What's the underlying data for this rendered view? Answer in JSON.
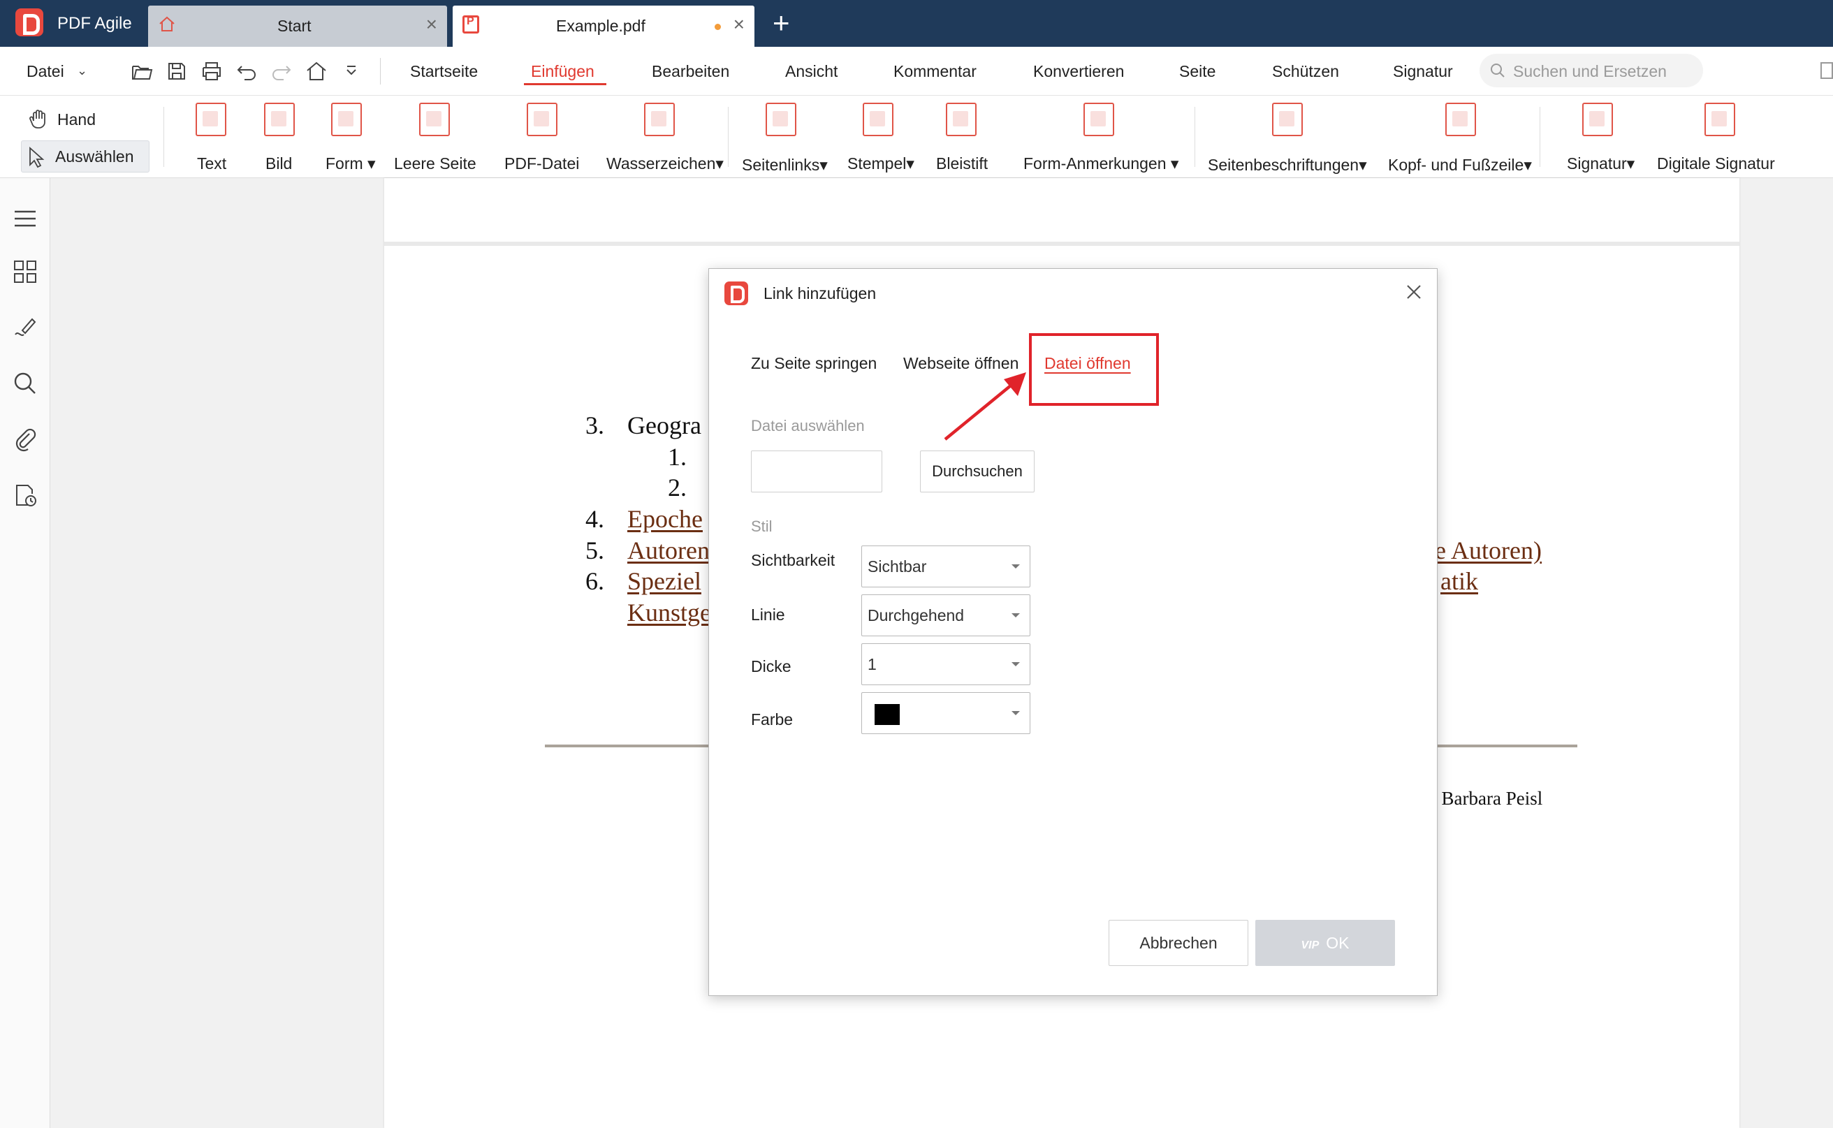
{
  "app": {
    "name": "PDF Agile",
    "tabs": [
      {
        "label": "Start"
      },
      {
        "label": "Example.pdf"
      }
    ]
  },
  "menubar": {
    "file_label": "Datei",
    "tabs": [
      "Startseite",
      "Einfügen",
      "Bearbeiten",
      "Ansicht",
      "Kommentar",
      "Konvertieren",
      "Seite",
      "Schützen",
      "Signatur"
    ],
    "active_tab": "Einfügen",
    "search_placeholder": "Suchen und Ersetzen"
  },
  "ribbon": {
    "hand_label": "Hand",
    "select_label": "Auswählen",
    "buttons": [
      "Text",
      "Bild",
      "Form ▾",
      "Leere Seite",
      "PDF-Datei",
      "Wasserzeichen▾",
      "Seitenlinks▾",
      "Stempel▾",
      "Bleistift",
      "Form-Anmerkungen ▾",
      "Seitenbeschriftungen▾",
      "Kopf- und Fußzeile▾",
      "Signatur▾",
      "Digitale Signatur"
    ]
  },
  "document": {
    "lines": [
      {
        "num": "3.",
        "text": "Geogra",
        "link": false
      },
      {
        "num": "1.",
        "text": "",
        "link": false
      },
      {
        "num": "2.",
        "text": "",
        "link": false
      },
      {
        "num": "4.",
        "text": "Epoche",
        "link": true
      },
      {
        "num": "5.",
        "text": "Autoren",
        "link": true
      },
      {
        "num": "6.",
        "text": "Speziel",
        "link": true
      },
      {
        "num": "",
        "text": "Kunstge",
        "link": true
      }
    ],
    "right_fragments": [
      "e Autoren)",
      "atik"
    ],
    "author": ", Barbara Peisl"
  },
  "dialog": {
    "title": "Link hinzufügen",
    "tabs": [
      "Zu Seite springen",
      "Webseite öffnen",
      "Datei öffnen"
    ],
    "active_tab": "Datei öffnen",
    "file_section_label": "Datei auswählen",
    "file_input_value": "",
    "browse_label": "Durchsuchen",
    "style_section_label": "Stil",
    "fields": {
      "visibility": {
        "label": "Sichtbarkeit",
        "value": "Sichtbar"
      },
      "line": {
        "label": "Linie",
        "value": "Durchgehend"
      },
      "thickness": {
        "label": "Dicke",
        "value": "1"
      },
      "color": {
        "label": "Farbe",
        "value": "#000000"
      }
    },
    "cancel_label": "Abbrechen",
    "ok_badge": "VIP",
    "ok_label": "OK"
  },
  "colors": {
    "titlebar": "#1f3a5a",
    "accent": "#e0392f",
    "link_text": "#6b2e12",
    "annotation": "#e0232a"
  }
}
